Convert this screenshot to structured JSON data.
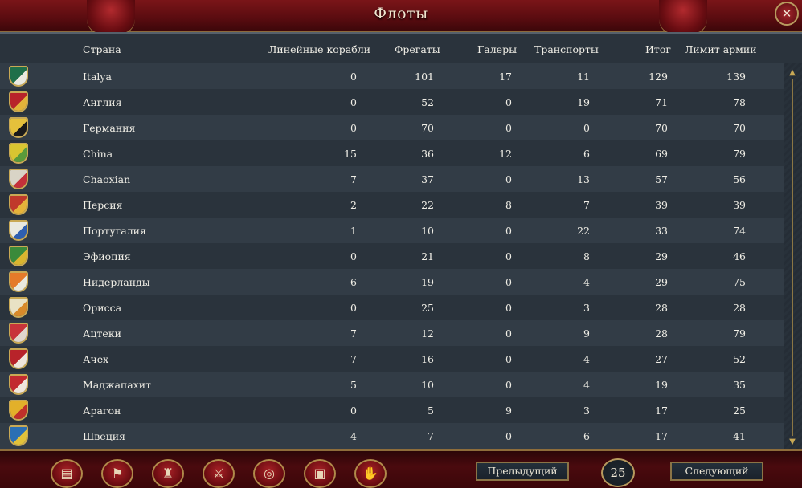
{
  "window": {
    "title": "Флоты"
  },
  "columns": {
    "country": "Страна",
    "heavy": "Линейные корабли",
    "light": "Фрегаты",
    "galleys": "Галеры",
    "transports": "Транспорты",
    "total": "Итог",
    "limit": "Лимит армии"
  },
  "rows": [
    {
      "country": "Italya",
      "heavy": "0",
      "light": "101",
      "galleys": "17",
      "transports": "11",
      "total": "129",
      "limit": "139",
      "flag": [
        "#1f6f4a",
        "#e9e9e0"
      ]
    },
    {
      "country": "Англия",
      "heavy": "0",
      "light": "52",
      "galleys": "0",
      "transports": "19",
      "total": "71",
      "limit": "78",
      "flag": [
        "#b8232a",
        "#e3b33a"
      ]
    },
    {
      "country": "Германия",
      "heavy": "0",
      "light": "70",
      "galleys": "0",
      "transports": "0",
      "total": "70",
      "limit": "70",
      "flag": [
        "#e5c13b",
        "#1a1a1a"
      ]
    },
    {
      "country": "China",
      "heavy": "15",
      "light": "36",
      "galleys": "12",
      "transports": "6",
      "total": "69",
      "limit": "79",
      "flag": [
        "#d9c531",
        "#5a9a3a"
      ]
    },
    {
      "country": "Chaoxian",
      "heavy": "7",
      "light": "37",
      "galleys": "0",
      "transports": "13",
      "total": "57",
      "limit": "56",
      "flag": [
        "#d9d4c6",
        "#c4313a"
      ]
    },
    {
      "country": "Персия",
      "heavy": "2",
      "light": "22",
      "galleys": "8",
      "transports": "7",
      "total": "39",
      "limit": "39",
      "flag": [
        "#c0392b",
        "#e6b33a"
      ]
    },
    {
      "country": "Португалия",
      "heavy": "1",
      "light": "10",
      "galleys": "0",
      "transports": "22",
      "total": "33",
      "limit": "74",
      "flag": [
        "#e9e9e0",
        "#2f5fb0"
      ]
    },
    {
      "country": "Эфиопия",
      "heavy": "0",
      "light": "21",
      "galleys": "0",
      "transports": "8",
      "total": "29",
      "limit": "46",
      "flag": [
        "#3b8a3a",
        "#d9b52f"
      ]
    },
    {
      "country": "Нидерланды",
      "heavy": "6",
      "light": "19",
      "galleys": "0",
      "transports": "4",
      "total": "29",
      "limit": "75",
      "flag": [
        "#e47a2a",
        "#e9e9e0"
      ]
    },
    {
      "country": "Орисса",
      "heavy": "0",
      "light": "25",
      "galleys": "0",
      "transports": "3",
      "total": "28",
      "limit": "28",
      "flag": [
        "#e9e2c4",
        "#d88a2a"
      ]
    },
    {
      "country": "Ацтеки",
      "heavy": "7",
      "light": "12",
      "galleys": "0",
      "transports": "9",
      "total": "28",
      "limit": "79",
      "flag": [
        "#c8343a",
        "#e0d6cc"
      ]
    },
    {
      "country": "Ачех",
      "heavy": "7",
      "light": "16",
      "galleys": "0",
      "transports": "4",
      "total": "27",
      "limit": "52",
      "flag": [
        "#b8232a",
        "#efe6dc"
      ]
    },
    {
      "country": "Маджапахит",
      "heavy": "5",
      "light": "10",
      "galleys": "0",
      "transports": "4",
      "total": "19",
      "limit": "35",
      "flag": [
        "#c22a30",
        "#efe6dc"
      ]
    },
    {
      "country": "Арагон",
      "heavy": "0",
      "light": "5",
      "galleys": "9",
      "transports": "3",
      "total": "17",
      "limit": "25",
      "flag": [
        "#e2b02a",
        "#c0302a"
      ]
    },
    {
      "country": "Швеция",
      "heavy": "4",
      "light": "7",
      "galleys": "0",
      "transports": "6",
      "total": "17",
      "limit": "41",
      "flag": [
        "#2a6fb4",
        "#e2c23a"
      ]
    }
  ],
  "bottom_buttons": [
    {
      "name": "ledger-icon",
      "glyph": "▤"
    },
    {
      "name": "flag-icon",
      "glyph": "⚑"
    },
    {
      "name": "buildings-icon",
      "glyph": "♜"
    },
    {
      "name": "crossed-swords-icon",
      "glyph": "⚔"
    },
    {
      "name": "coins-icon",
      "glyph": "◎"
    },
    {
      "name": "crate-icon",
      "glyph": "▣"
    },
    {
      "name": "handshake-icon",
      "glyph": "✋"
    }
  ],
  "navigation": {
    "prev": "Предыдущий",
    "next": "Следующий",
    "page": "25"
  }
}
